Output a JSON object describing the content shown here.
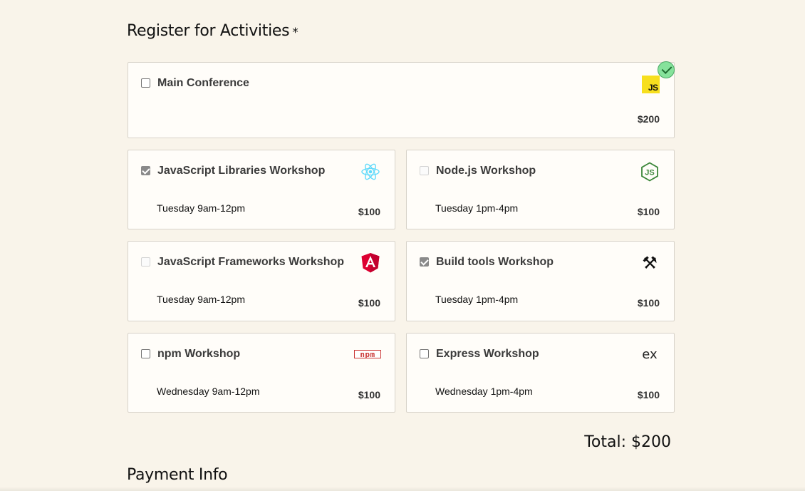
{
  "section_title": "Register for Activities",
  "required_marker": "*",
  "activities": [
    {
      "id": "main",
      "name": "Main Conference",
      "time": "",
      "price": "$200",
      "checked": false,
      "disabled": false,
      "icon": "javascript-icon"
    },
    {
      "id": "js-libs",
      "name": "JavaScript Libraries Workshop",
      "time": "Tuesday 9am-12pm",
      "price": "$100",
      "checked": true,
      "disabled": false,
      "icon": "react-icon"
    },
    {
      "id": "node",
      "name": "Node.js Workshop",
      "time": "Tuesday 1pm-4pm",
      "price": "$100",
      "checked": false,
      "disabled": true,
      "icon": "nodejs-icon"
    },
    {
      "id": "js-frameworks",
      "name": "JavaScript Frameworks Workshop",
      "time": "Tuesday 9am-12pm",
      "price": "$100",
      "checked": false,
      "disabled": true,
      "icon": "angular-icon"
    },
    {
      "id": "build-tools",
      "name": "Build tools Workshop",
      "time": "Tuesday 1pm-4pm",
      "price": "$100",
      "checked": true,
      "disabled": false,
      "icon": "hammer-wrench-icon"
    },
    {
      "id": "npm",
      "name": "npm Workshop",
      "time": "Wednesday 9am-12pm",
      "price": "$100",
      "checked": false,
      "disabled": false,
      "icon": "npm-icon"
    },
    {
      "id": "express",
      "name": "Express Workshop",
      "time": "Wednesday 1pm-4pm",
      "price": "$100",
      "checked": false,
      "disabled": false,
      "icon": "express-icon"
    }
  ],
  "js_logo_text": "JS",
  "total_label": "Total: $200",
  "payment_title": "Payment Info",
  "colors": {
    "background": "#f9f4ea",
    "card": "#fffdf9",
    "valid_badge": "#86e29b",
    "js_yellow": "#f7df1e",
    "react_cyan": "#61dafb",
    "node_green": "#3c873a",
    "angular_red": "#dd0031",
    "npm_red": "#cb3837"
  }
}
